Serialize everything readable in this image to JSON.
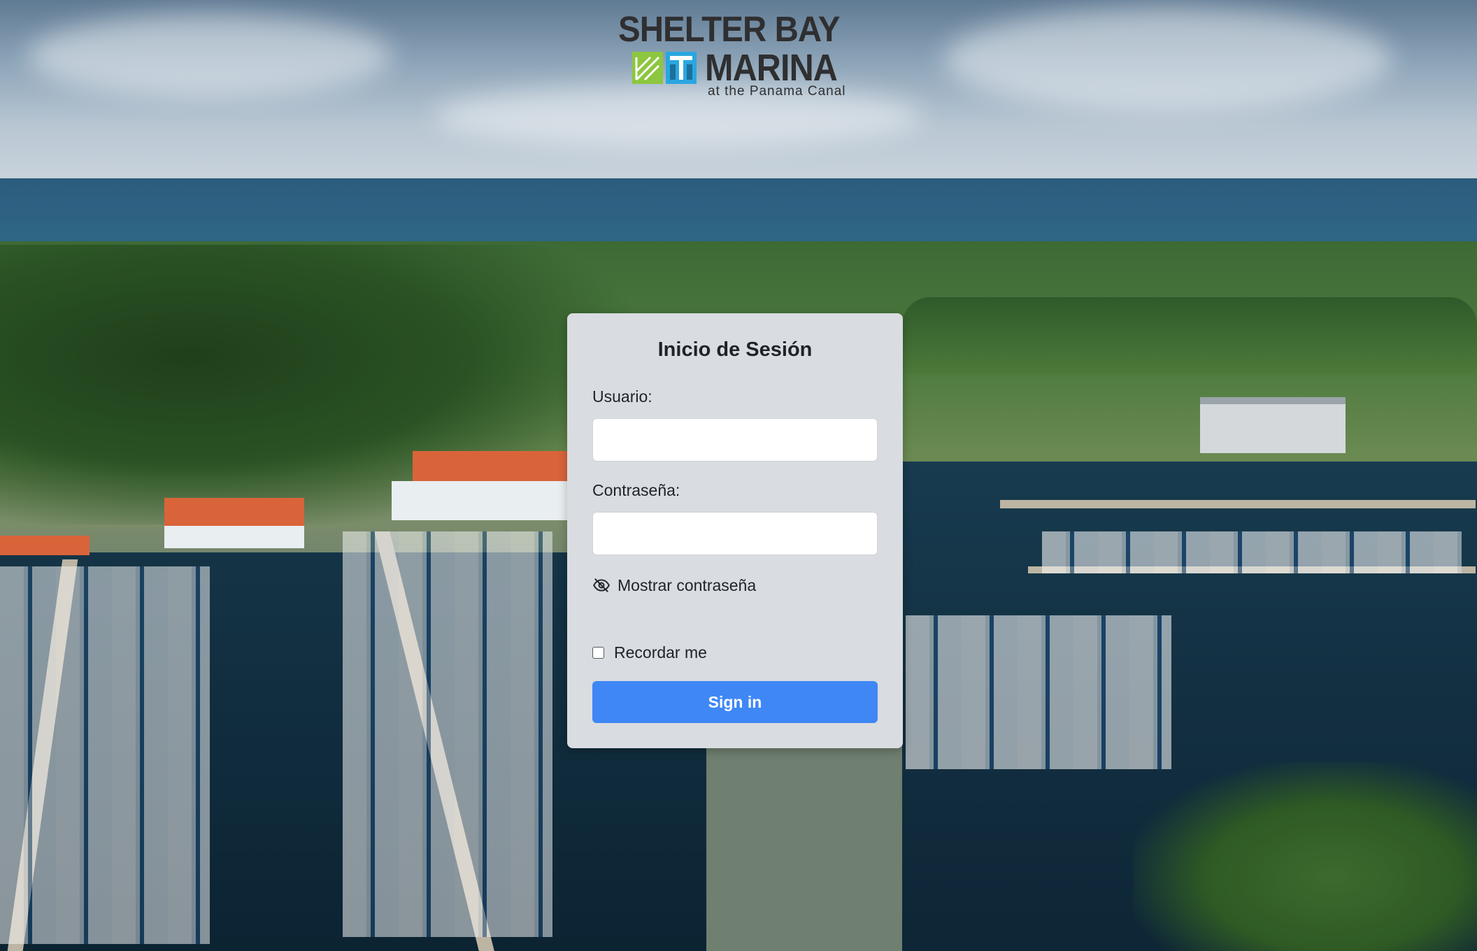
{
  "logo": {
    "line1": "SHELTER BAY",
    "line2": "MARINA",
    "tagline": "at the Panama Canal"
  },
  "login": {
    "title": "Inicio de Sesión",
    "username_label": "Usuario:",
    "username_value": "",
    "password_label": "Contraseña:",
    "password_value": "",
    "show_password_label": "Mostrar contraseña",
    "show_password_icon": "eye-slash-icon",
    "remember_label": "Recordar me",
    "remember_checked": false,
    "submit_label": "Sign in"
  },
  "colors": {
    "card_background": "#d9dce0",
    "button_primary": "#3f87f5",
    "logo_text": "#2f2f31",
    "logo_green": "#8dc63f",
    "logo_blue": "#2aa6df"
  }
}
